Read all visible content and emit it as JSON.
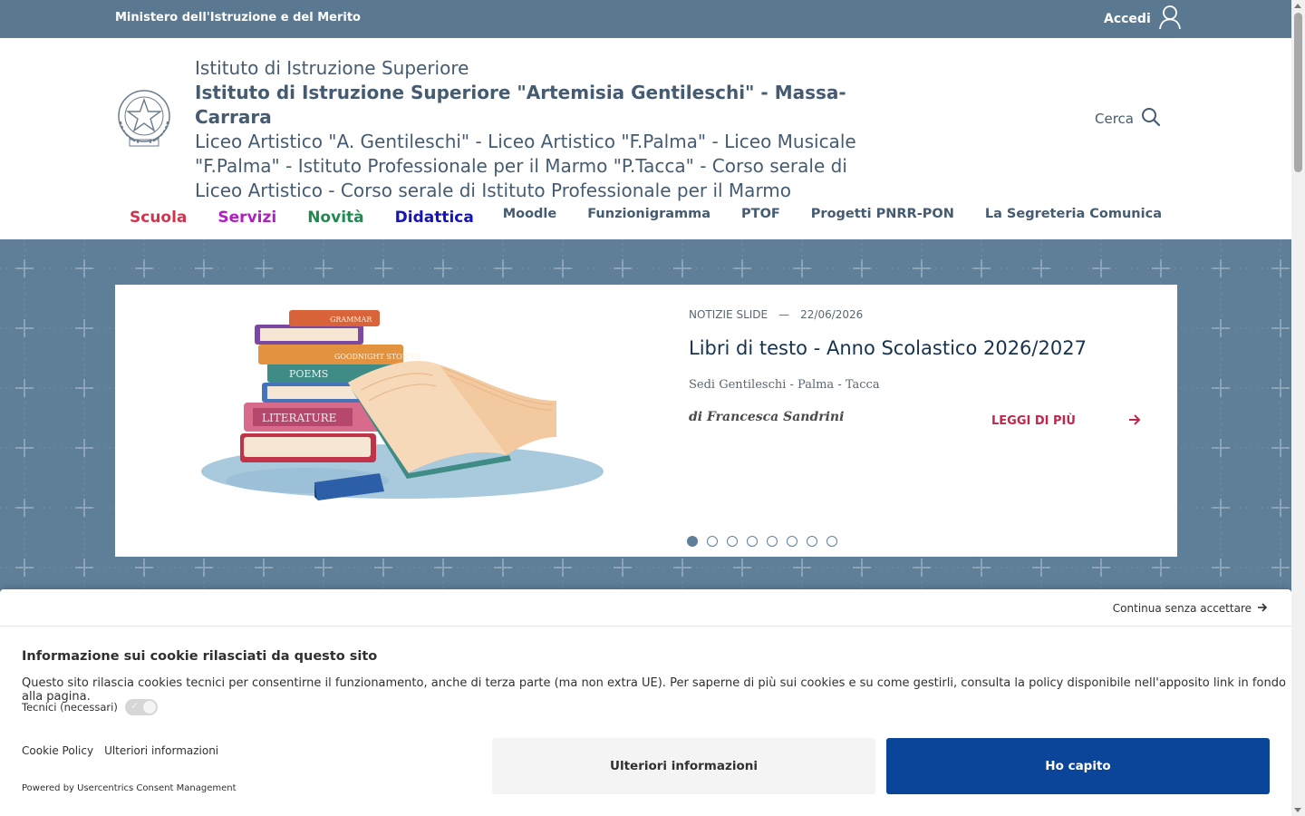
{
  "topbar": {
    "ministry": "Ministero dell'Istruzione e del Merito",
    "login_label": "Accedi",
    "login_icon": "user-icon",
    "bg_color": "#5b7891"
  },
  "header": {
    "brand_line1": "Istituto di Istruzione Superiore",
    "brand_line2": "Istituto di Istruzione Superiore \"Artemisia Gentileschi\" - Massa-Carrara",
    "brand_line3": "Liceo Artistico \"A. Gentileschi\" - Liceo Artistico \"F.Palma\" - Liceo Musicale \"F.Palma\" - Istituto Professionale per il Marmo \"P.Tacca\" - Corso serale di Liceo Artistico - Corso serale di Istituto Professionale per il Marmo",
    "search_label": "Cerca",
    "search_icon": "search-icon",
    "emblem_icon": "italian-republic-emblem-icon"
  },
  "main_nav": [
    {
      "label": "Scuola",
      "color": "#d1344c"
    },
    {
      "label": "Servizi",
      "color": "#b01fbf"
    },
    {
      "label": "Novità",
      "color": "#1e8a4f"
    },
    {
      "label": "Didattica",
      "color": "#1414b8"
    }
  ],
  "secondary_nav": [
    "Moodle",
    "Funzionigramma",
    "PTOF",
    "Progetti PNRR-PON",
    "La Segreteria Comunica"
  ],
  "slide": {
    "category": "NOTIZIE SLIDE",
    "separator": "—",
    "date": "22/06/2026",
    "title": "Libri di testo - Anno Scolastico 2026/2027",
    "subtitle": "Sedi Gentileschi - Palma - Tacca",
    "author": "di Francesca Sandrini",
    "read_more": "LEGGI DI PIÙ",
    "read_more_icon": "arrow-right-icon",
    "illustration": "stack-of-books-illustration",
    "book_labels": [
      "GRAMMAR",
      "GOODNIGHT STORIES",
      "POEMS",
      "LITERATURE"
    ],
    "dots_total": 8,
    "dot_active": 1
  },
  "cookie": {
    "continue_label": "Continua senza accettare",
    "continue_icon": "arrow-right-icon",
    "title": "Informazione sui cookie rilasciati da questo sito",
    "text": "Questo sito rilascia cookies tecnici per consentirne il funzionamento, anche di terza parte (ma non extra UE). Per saperne di più sui cookies e su come gestirli, consulta la policy disponibile nell'apposito link in fondo alla pagina.",
    "tech_label": "Tecnici (necessari)",
    "tech_enabled": true,
    "link_policy": "Cookie Policy",
    "link_more": "Ulteriori informazioni",
    "powered": "Powered by Usercentrics Consent Management",
    "btn_more": "Ulteriori informazioni",
    "btn_ok": "Ho capito",
    "btn_ok_color": "#0a4599"
  }
}
